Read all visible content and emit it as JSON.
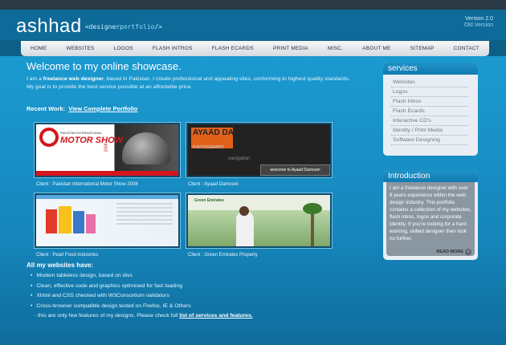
{
  "header": {
    "logo": "ashhad",
    "tag_prefix": "<designer",
    "tag_highlight": "portfolio",
    "tag_suffix": "/>",
    "version": "Version 2.0",
    "old_version": "Old Version"
  },
  "nav": [
    "HOME",
    "WEBSITES",
    "LOGOS",
    "FLASH INTROS",
    "FLASH ECARDS",
    "PRINT MEDIA",
    "MISC.",
    "ABOUT ME",
    "SITEMAP",
    "CONTACT"
  ],
  "main": {
    "title": "Welcome to my online showcase.",
    "intro_prefix": "I am a",
    "intro_bold": "freelance web designer",
    "intro_rest": ", based in Pakistan. I create professional and appealing sites, conforming to highest quality standards. My goal is to provide the best service possible at an affordable price.",
    "recent_label": "Recent Work:",
    "recent_link": "View Complete Portfolio",
    "works": [
      {
        "caption": "Client : Pakistan International Motor Show 2008",
        "shot_text": "MOTOR SHOW",
        "shot_small": "PAKISTAN INTERNATIONAL",
        "shot_year": "2008"
      },
      {
        "caption": "Client : Ayaad Damouni",
        "shot_text": "AYAAD DAMOUNI",
        "shot_small": "PHOTOGRAPHY",
        "shot_nav": "navigation",
        "shot_welcome": "welcome to Ayaad Damouni"
      },
      {
        "caption": "Client : Pearl Food Industries"
      },
      {
        "caption": "Client : Green Emirates Property",
        "shot_brand": "Green Emirates"
      }
    ],
    "features_title": "All my websites have:",
    "features": [
      "Modern tableless design, based on divs",
      "Clean, effective code and graphics optimised for fast loading",
      "Xhtml and CSS checked with W3Consortium validators",
      "Cross-browser compatible design tested on Firefox, IE & Others"
    ],
    "features_note": "- this are only few features of my designs. Please check full",
    "features_link": "list of services and features."
  },
  "services": {
    "title": "services",
    "items": [
      "Websites",
      "Logos",
      "Flash Intros",
      "Flash Ecards",
      "Interactive CD's",
      "Identity / Print Media",
      "Software Designing"
    ]
  },
  "introduction": {
    "title": "Introduction",
    "text": "I am a freelance designer with over 8 years experience within the web design industry. This portfolio contains a collection of my websites, flash intros, logos and corporate identity. If you're looking for a hard working, skilled designer then look no further.",
    "read_more": "READ MORE"
  },
  "colors": {
    "accent": "#1b9ad0",
    "header": "#0e6a98",
    "brand_red": "#d4161c"
  }
}
